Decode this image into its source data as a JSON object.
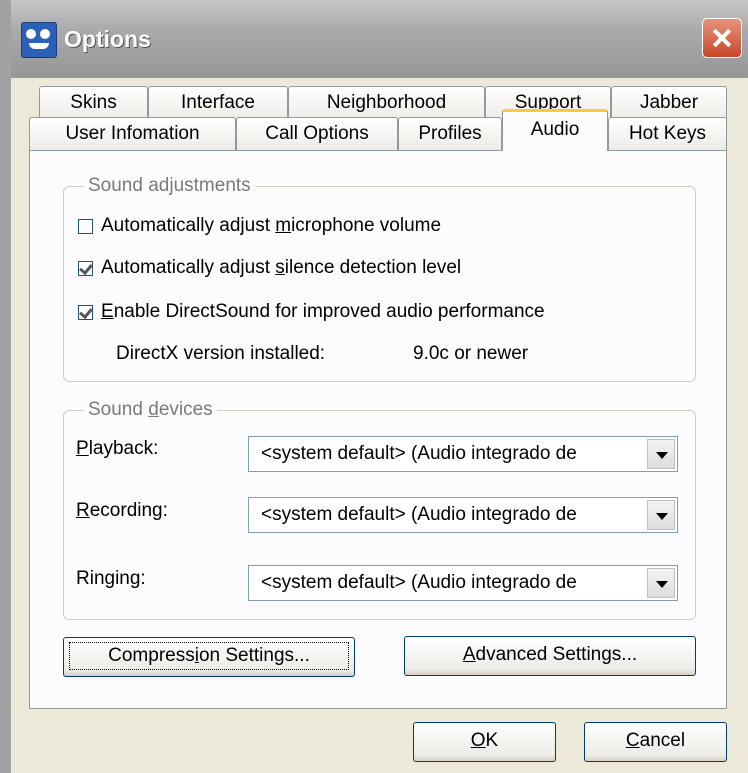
{
  "window": {
    "title": "Options"
  },
  "tabs_row1": [
    {
      "label": "Skins"
    },
    {
      "label": "Interface"
    },
    {
      "label": "Neighborhood"
    },
    {
      "label": "Support"
    },
    {
      "label": "Jabber"
    }
  ],
  "tabs_row2": [
    {
      "label": "User Infomation"
    },
    {
      "label": "Call Options"
    },
    {
      "label": "Profiles"
    },
    {
      "label": "Audio",
      "active": true
    },
    {
      "label": "Hot Keys"
    }
  ],
  "sound_adjustments": {
    "title": "Sound adjustments",
    "options": [
      {
        "pre": "Automatically adjust ",
        "ul": "m",
        "post": "icrophone volume",
        "checked": false
      },
      {
        "pre": "Automatically adjust ",
        "ul": "s",
        "post": "ilence detection level",
        "checked": true
      },
      {
        "pre": "",
        "ul": "E",
        "post": "nable DirectSound for improved audio performance",
        "checked": true
      }
    ],
    "directx_label": "DirectX version installed:",
    "directx_value": "9.0c or newer"
  },
  "sound_devices": {
    "title_pre": "Sound ",
    "title_ul": "d",
    "title_post": "evices",
    "playback": {
      "ul": "P",
      "rest": "layback:",
      "value": "<system default> (Audio integrado de"
    },
    "recording": {
      "ul": "R",
      "rest": "ecording:",
      "value": "<system default> (Audio integrado de"
    },
    "ringing": {
      "label": "Ringing:",
      "value": "<system default> (Audio integrado de"
    }
  },
  "buttons": {
    "compression": {
      "pre": "Compress",
      "ul": "i",
      "post": "on Settings..."
    },
    "advanced": {
      "ul": "A",
      "post": "dvanced Settings..."
    },
    "ok": {
      "ul": "O",
      "post": "K"
    },
    "cancel": {
      "ul": "C",
      "post": "ancel"
    }
  },
  "colors": {
    "close": "#c9482c",
    "tab_highlight": "#ffc83c",
    "face": "#ece9d8"
  }
}
